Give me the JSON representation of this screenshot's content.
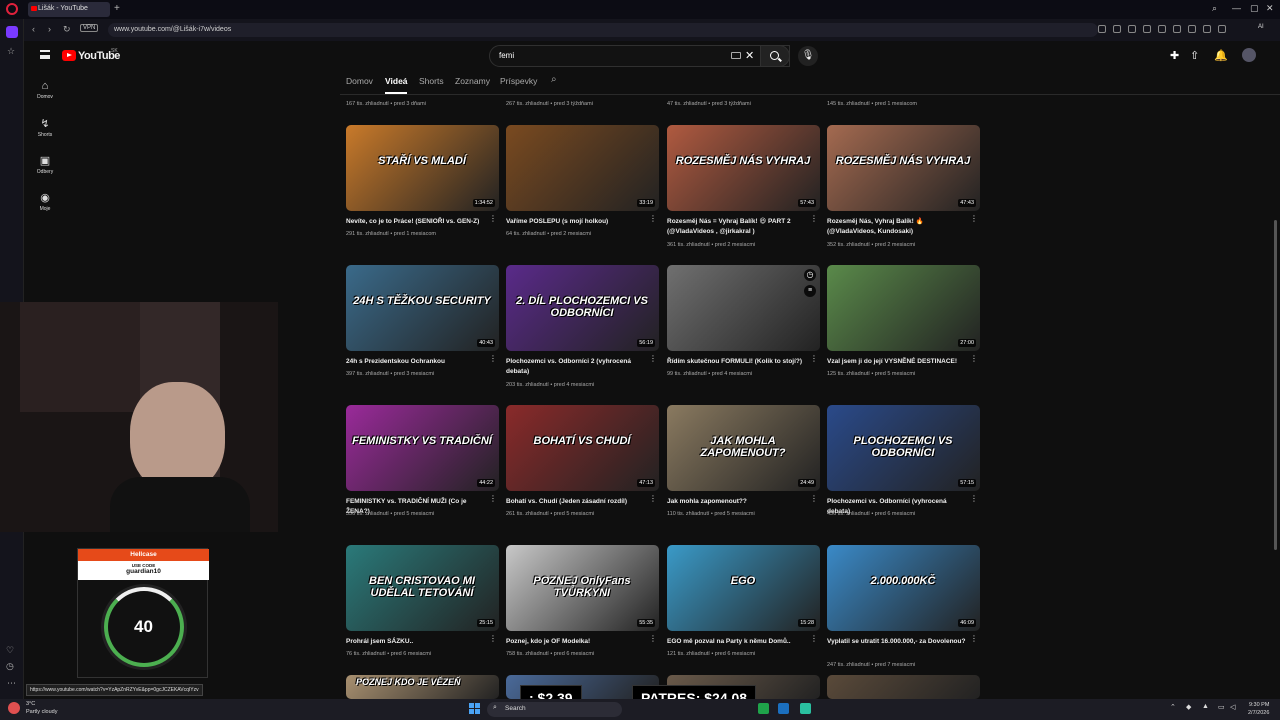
{
  "browser": {
    "tab_title": "Lišák - YouTube",
    "url": "www.youtube.com/@Lišák-i7w/videos",
    "vpn_label": "VPN",
    "ai_label": "AI"
  },
  "youtube": {
    "logo_text": "YouTube",
    "country_code": "SK",
    "search_value": "femi",
    "guide": [
      {
        "label": "Domov",
        "icon": "home-icon"
      },
      {
        "label": "Shorts",
        "icon": "shorts-icon"
      },
      {
        "label": "Odbery",
        "icon": "subscriptions-icon"
      },
      {
        "label": "Moje",
        "icon": "you-icon"
      }
    ],
    "tabs": [
      "Domov",
      "Videá",
      "Shorts",
      "Zoznamy",
      "Príspevky"
    ],
    "active_tab": "Videá",
    "top_partial_meta": [
      "167 tis. zhliadnutí • pred 3 dňami",
      "267 tis. zhliadnutí • pred 3 týždňami",
      "47 tis. zhliadnutí • pred 3 týždňami",
      "145 tis. zhliadnutí • pred 1 mesiacom"
    ],
    "videos": [
      {
        "title": "Nevíte, co je to Práce! (SENIOŘI vs. GEN-Z)",
        "meta": "291 tis. zhliadnutí • pred 1 mesiacom",
        "duration": "1:34:52",
        "thumb_text": "STAŘÍ VS MLADÍ",
        "bg": "#c97a2a"
      },
      {
        "title": "Vaříme POSLEPU (s mojí holkou)",
        "meta": "64 tis. zhliadnutí • pred 2 mesiacmi",
        "duration": "33:19",
        "thumb_text": "",
        "bg": "#7a4a20"
      },
      {
        "title": "Rozesměj Nás = Vyhraj Balík! 😆 PART 2 (@VladaVideos , @jirkakral )",
        "meta": "361 tis. zhliadnutí • pred 2 mesiacmi",
        "duration": "57:43",
        "thumb_text": "ROZESMĚJ NÁS VYHRAJ",
        "bg": "#b05a40"
      },
      {
        "title": "Rozesměj Nás, Vyhraj Balík! 🔥 (@VladaVideos, Kundosaki)",
        "meta": "352 tis. zhliadnutí • pred 2 mesiacmi",
        "duration": "47:43",
        "thumb_text": "ROZESMĚJ NÁS VYHRAJ",
        "bg": "#a46a50"
      },
      {
        "title": "24h s Prezidentskou Ochrankou",
        "meta": "397 tis. zhliadnutí • pred 3 mesiacmi",
        "duration": "40:43",
        "thumb_text": "24H S TĚŽKOU SECURITY",
        "bg": "#3a6a8a"
      },
      {
        "title": "Plochozemci vs. Odborníci 2 (vyhrocená debata)",
        "meta": "203 tis. zhliadnutí • pred 4 mesiacmi",
        "duration": "56:19",
        "thumb_text": "2. DÍL PLOCHOZEMCI VS ODBORNÍCI",
        "bg": "#5a2a8a"
      },
      {
        "title": "Řídím skutečnou FORMULI! (Kolik to stojí?)",
        "meta": "99 tis. zhliadnutí • pred 4 mesiacmi",
        "duration": "",
        "thumb_text": "",
        "bg": "#707070"
      },
      {
        "title": "Vzal jsem ji do její VYSNĚNÉ DESTINACE!",
        "meta": "125 tis. zhliadnutí • pred 5 mesiacmi",
        "duration": "27:00",
        "thumb_text": "",
        "bg": "#5a8a4a"
      },
      {
        "title": "FEMINISTKY vs. TRADIČNÍ MUŽI (Co je ŽENA?)",
        "meta": "356 tis. zhliadnutí • pred 5 mesiacmi",
        "duration": "44:22",
        "thumb_text": "FEMINISTKY VS TRADIČNÍ",
        "bg": "#9a2a9a"
      },
      {
        "title": "Bohatí vs. Chudí (Jeden zásadní rozdíl)",
        "meta": "261 tis. zhliadnutí • pred 5 mesiacmi",
        "duration": "47:13",
        "thumb_text": "BOHATÍ VS CHUDÍ",
        "bg": "#8a2a2a"
      },
      {
        "title": "Jak mohla zapomenout??",
        "meta": "110 tis. zhliadnutí • pred 5 mesiacmi",
        "duration": "24:49",
        "thumb_text": "JAK MOHLA ZAPOMENOUT?",
        "bg": "#8a7a60"
      },
      {
        "title": "Plochozemci vs. Odborníci (vyhrocená debata)",
        "meta": "436 tis. zhliadnutí • pred 6 mesiacmi",
        "duration": "57:15",
        "thumb_text": "PLOCHOZEMCI VS ODBORNÍCI",
        "bg": "#2a4a8a"
      },
      {
        "title": "Prohrál jsem SÁZKU..",
        "meta": "76 tis. zhliadnutí • pred 6 mesiacmi",
        "duration": "25:15",
        "thumb_text": "BEN CRISTOVAO MI UDĚLAL TETOVÁNÍ",
        "bg": "#2a7a7a"
      },
      {
        "title": "Poznej, kdo je OF Modelka!",
        "meta": "758 tis. zhliadnutí • pred 6 mesiacmi",
        "duration": "55:35",
        "thumb_text": "POZNEJ OnlyFans TVŮRKYNI",
        "bg": "#c8c8c8"
      },
      {
        "title": "EGO mě pozval na Party k němu Domů..",
        "meta": "121 tis. zhliadnutí • pred 6 mesiacmi",
        "duration": "15:28",
        "thumb_text": "EGO",
        "bg": "#3a9ac8"
      },
      {
        "title": "Vyplatil se utratit 16.000.000,- za Dovolenou?",
        "meta": "247 tis. zhliadnutí • pred 7 mesiacmi",
        "duration": "46:09",
        "thumb_text": "2.000.000KČ",
        "bg": "#3a8ac8"
      }
    ],
    "bottom_partial_thumbs": [
      {
        "thumb_text": "POZNEJ KDO JE VĚZEŇ",
        "bg": "#a89070"
      },
      {
        "thumb_text": "",
        "bg": "#4a6a9a"
      },
      {
        "thumb_text": "",
        "bg": "#6a5a4a"
      },
      {
        "thumb_text": "",
        "bg": "#5a4a3a"
      }
    ]
  },
  "overlays": {
    "hellcase_brand": "Hellcase",
    "hellcase_use_code": "USE CODE",
    "hellcase_code": "guardian10",
    "timer": "40",
    "money_left": ": $2.39",
    "money_right": "PATRES: $24.08",
    "status_url": "https://www.youtube.com/watch?v=YzApZnRZYvE&pp=0gcJCZEKAVcqIYzv"
  },
  "taskbar": {
    "temp": "3°C",
    "weather": "Partly cloudy",
    "search_label": "Search",
    "time": "9:30 PM",
    "date": "2/7/2026"
  }
}
